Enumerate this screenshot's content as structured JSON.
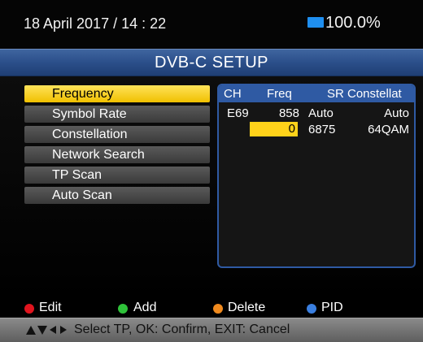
{
  "status": {
    "datetime": "18 April 2017 / 14 : 22",
    "battery": "100.0%",
    "battery_color": "#1f8ff0"
  },
  "title": "DVB-C SETUP",
  "menu": {
    "items": [
      {
        "label": "Frequency",
        "selected": true
      },
      {
        "label": "Symbol Rate",
        "selected": false
      },
      {
        "label": "Constellation",
        "selected": false
      },
      {
        "label": "Network Search",
        "selected": false
      },
      {
        "label": "TP Scan",
        "selected": false
      },
      {
        "label": "Auto Scan",
        "selected": false
      }
    ]
  },
  "table": {
    "headers": [
      "CH",
      "Freq",
      "SR",
      "Constellat"
    ],
    "row1": {
      "ch": "E69",
      "freq": "858",
      "sr": "Auto",
      "constellation": "Auto"
    },
    "row2": {
      "freq": "0",
      "sr": "6875",
      "constellation": "64QAM"
    }
  },
  "legend": {
    "edit": "Edit",
    "add": "Add",
    "delete": "Delete",
    "pid": "PID",
    "colors": {
      "edit": "#e0141e",
      "add": "#2fc23a",
      "delete": "#f08a1e",
      "pid": "#3a7fe0"
    }
  },
  "hint": {
    "text": "Select TP, OK: Confirm, EXIT: Cancel",
    "icon": "arrow-keys-icon"
  }
}
